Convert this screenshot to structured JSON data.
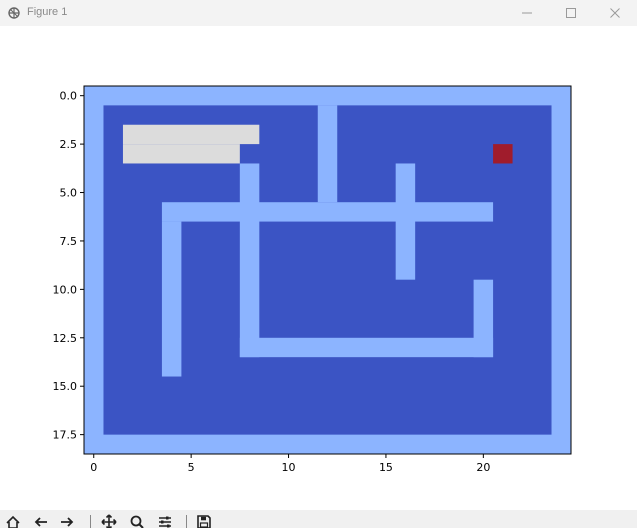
{
  "window": {
    "title": "Figure 1",
    "icons": {
      "app": "matplotlib-figure-icon",
      "minimize": "minimize-icon",
      "maximize": "maximize-icon",
      "close": "close-icon"
    }
  },
  "toolbar": {
    "tools": [
      "home-icon",
      "back-arrow-icon",
      "forward-arrow-icon",
      "pan-icon",
      "zoom-icon",
      "configure-subplots-icon",
      "save-icon"
    ]
  },
  "chart_data": {
    "type": "heatmap",
    "xlim": [
      -0.5,
      24.5
    ],
    "ylim": [
      18.5,
      -0.5
    ],
    "xticks": [
      0,
      5,
      10,
      15,
      20
    ],
    "xtick_labels": [
      "0",
      "5",
      "10",
      "15",
      "20"
    ],
    "yticks": [
      0,
      2.5,
      5,
      7.5,
      10,
      12.5,
      15,
      17.5
    ],
    "ytick_labels": [
      "0.0",
      "2.5",
      "5.0",
      "7.5",
      "10.0",
      "12.5",
      "15.0",
      "17.5"
    ],
    "grid": false,
    "colors": {
      "wall": "#8cb4ff",
      "floor": "#3b54c4",
      "visited": "#dcdcdc",
      "goal": "#a01c2c"
    },
    "cells": [
      {
        "kind": "wall",
        "x": [
          -0.5,
          24.5
        ],
        "y": [
          -0.5,
          18.5
        ]
      },
      {
        "kind": "floor",
        "x": [
          0.5,
          23.5
        ],
        "y": [
          0.5,
          17.5
        ]
      },
      {
        "kind": "wall",
        "x": [
          11.5,
          12.5
        ],
        "y": [
          0.5,
          5.5
        ]
      },
      {
        "kind": "wall",
        "x": [
          15.5,
          16.5
        ],
        "y": [
          3.5,
          9.5
        ]
      },
      {
        "kind": "wall",
        "x": [
          3.5,
          20.5
        ],
        "y": [
          5.5,
          6.5
        ]
      },
      {
        "kind": "wall",
        "x": [
          3.5,
          4.5
        ],
        "y": [
          6.5,
          14.5
        ]
      },
      {
        "kind": "wall",
        "x": [
          7.5,
          8.5
        ],
        "y": [
          3.5,
          13.5
        ]
      },
      {
        "kind": "wall",
        "x": [
          7.5,
          20.5
        ],
        "y": [
          12.5,
          13.5
        ]
      },
      {
        "kind": "wall",
        "x": [
          19.5,
          20.5
        ],
        "y": [
          9.5,
          13.5
        ]
      },
      {
        "kind": "visited",
        "x": [
          1.5,
          8.5
        ],
        "y": [
          1.5,
          2.5
        ]
      },
      {
        "kind": "visited",
        "x": [
          1.5,
          7.5
        ],
        "y": [
          2.5,
          3.5
        ]
      },
      {
        "kind": "goal",
        "x": [
          20.5,
          21.5
        ],
        "y": [
          2.5,
          3.5
        ]
      }
    ]
  }
}
